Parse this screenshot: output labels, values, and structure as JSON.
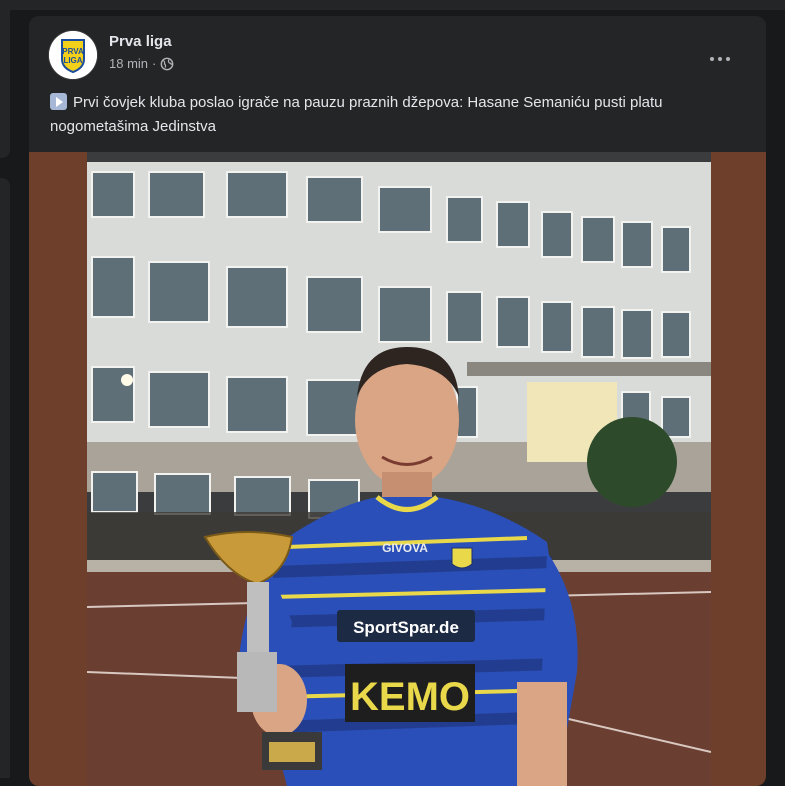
{
  "post": {
    "page_name": "Prva liga",
    "timestamp": "18 min",
    "separator": "·",
    "audience_icon": "globe-icon",
    "avatar_text_top": "PRVA",
    "avatar_text_bottom": "LIGA",
    "caption": "Prvi čovjek kluba poslao igrače na pauzu praznih džepova: Hasane Semaniću pusti platu nogometašima Jedinstva",
    "caption_emoji": "play-button-emoji",
    "more_icon": "more-options-icon"
  },
  "photo": {
    "jersey_brand": "GIVOVA",
    "sponsor": "SportSpar.de",
    "name_on_shirt": "KEMO"
  },
  "colors": {
    "background": "#18191a",
    "card": "#242526",
    "text_primary": "#e4e6eb",
    "text_secondary": "#b0b3b8",
    "photo_border": "#6e3f2a"
  }
}
